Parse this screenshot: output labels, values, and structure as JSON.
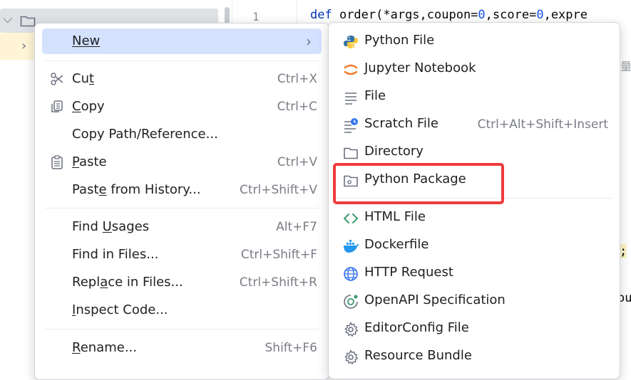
{
  "editor": {
    "line_number": "1",
    "code_kw": "def",
    "code_name": " order(*args,coupon=",
    "code_num1": "0",
    "code_mid": ",score=",
    "code_num2": "0",
    "code_tail": ",expre",
    "frag_glyph": "量",
    "frag_semi": ";",
    "frag_ou": "ou"
  },
  "project": {
    "root_expand": "⌵",
    "child_expand": "›"
  },
  "context_menu": {
    "new": {
      "label": "New",
      "arrow": "›"
    },
    "cut": {
      "pre": "Cu",
      "u": "t",
      "post": "",
      "shortcut": "Ctrl+X"
    },
    "copy": {
      "pre": "",
      "u": "C",
      "post": "opy",
      "shortcut": "Ctrl+C"
    },
    "copy_path": {
      "label": "Copy Path/Reference..."
    },
    "paste": {
      "pre": "",
      "u": "P",
      "post": "aste",
      "shortcut": "Ctrl+V"
    },
    "paste_history": {
      "pre": "Past",
      "u": "e",
      "post": " from History...",
      "shortcut": "Ctrl+Shift+V"
    },
    "find_usages": {
      "pre": "Find ",
      "u": "U",
      "post": "sages",
      "shortcut": "Alt+F7"
    },
    "find_in_files": {
      "label": "Find in Files...",
      "shortcut": "Ctrl+Shift+F"
    },
    "replace_in_files": {
      "pre": "Repl",
      "u": "a",
      "post": "ce in Files...",
      "shortcut": "Ctrl+Shift+R"
    },
    "inspect_code": {
      "pre": "",
      "u": "I",
      "post": "nspect Code..."
    },
    "rename": {
      "pre": "",
      "u": "R",
      "post": "ename...",
      "shortcut": "Shift+F6"
    }
  },
  "new_submenu": {
    "items": [
      {
        "label": "Python File",
        "icon": "python-icon"
      },
      {
        "label": "Jupyter Notebook",
        "icon": "jupyter-icon"
      },
      {
        "label": "File",
        "icon": "file-icon"
      },
      {
        "label": "Scratch File",
        "icon": "scratch-file-icon",
        "shortcut": "Ctrl+Alt+Shift+Insert"
      },
      {
        "label": "Directory",
        "icon": "folder-icon"
      },
      {
        "label": "Python Package",
        "icon": "python-package-icon"
      },
      {
        "label": "HTML File",
        "icon": "html-icon"
      },
      {
        "label": "Dockerfile",
        "icon": "docker-icon"
      },
      {
        "label": "HTTP Request",
        "icon": "globe-icon"
      },
      {
        "label": "OpenAPI Specification",
        "icon": "openapi-icon"
      },
      {
        "label": "EditorConfig File",
        "icon": "gear-icon"
      },
      {
        "label": "Resource Bundle",
        "icon": "gear-icon"
      }
    ]
  },
  "colors": {
    "menu_active": "#d4e2ff",
    "highlight_border": "#ef3b3b",
    "python_blue": "#3572a5",
    "python_yellow": "#f7c93e",
    "jupyter_orange": "#f37726",
    "html_green": "#3d9970",
    "docker_blue": "#2396ed"
  }
}
